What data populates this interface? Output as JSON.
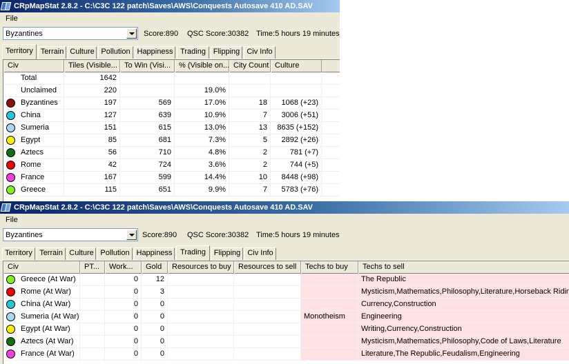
{
  "top_window": {
    "title": "CRpMapStat 2.8.2 - C:\\C3C 122 patch\\Saves\\AWS\\Conquests Autosave 410 AD.SAV",
    "menu": [
      "File"
    ],
    "civ_select": "Byzantines",
    "score": "Score:890",
    "qsc_score": "QSC Score:30382",
    "time": "Time:5 hours 19 minutes",
    "tabs": [
      "Territory",
      "Terrain",
      "Culture",
      "Pollution",
      "Happiness",
      "Trading",
      "Flipping",
      "Civ Info"
    ],
    "active_tab": "Territory",
    "columns": [
      "Civ",
      "Tiles (Visible...",
      "To Win (Visi...",
      "% (Visible on...",
      "City Count",
      "Culture"
    ],
    "rows": [
      {
        "civ": "Total",
        "tiles": "1642",
        "to_win": "",
        "pct": "",
        "cities": "",
        "culture": ""
      },
      {
        "civ": "Unclaimed",
        "tiles": "220",
        "to_win": "",
        "pct": "19.0%",
        "cities": "",
        "culture": ""
      },
      {
        "civ": "Byzantines",
        "color": "#8b1010",
        "tiles": "197",
        "to_win": "569",
        "pct": "17.0%",
        "cities": "18",
        "culture": "1068 (+23)"
      },
      {
        "civ": "China",
        "color": "#20c8d8",
        "tiles": "127",
        "to_win": "639",
        "pct": "10.9%",
        "cities": "7",
        "culture": "3006 (+51)"
      },
      {
        "civ": "Sumeria",
        "color": "#a8d8f0",
        "tiles": "151",
        "to_win": "615",
        "pct": "13.0%",
        "cities": "13",
        "culture": "8635 (+152)"
      },
      {
        "civ": "Egypt",
        "color": "#f8f000",
        "tiles": "85",
        "to_win": "681",
        "pct": "7.3%",
        "cities": "5",
        "culture": "2892 (+26)"
      },
      {
        "civ": "Aztecs",
        "color": "#107010",
        "tiles": "56",
        "to_win": "710",
        "pct": "4.8%",
        "cities": "2",
        "culture": "781 (+7)"
      },
      {
        "civ": "Rome",
        "color": "#f00000",
        "tiles": "42",
        "to_win": "724",
        "pct": "3.6%",
        "cities": "2",
        "culture": "744 (+5)"
      },
      {
        "civ": "France",
        "color": "#f040e0",
        "tiles": "167",
        "to_win": "599",
        "pct": "14.4%",
        "cities": "10",
        "culture": "8448 (+98)"
      },
      {
        "civ": "Greece",
        "color": "#80f020",
        "tiles": "115",
        "to_win": "651",
        "pct": "9.9%",
        "cities": "7",
        "culture": "5783 (+76)"
      }
    ]
  },
  "bottom_window": {
    "title": "CRpMapStat 2.8.2 - C:\\C3C 122 patch\\Saves\\AWS\\Conquests Autosave 410 AD.SAV",
    "menu": [
      "File"
    ],
    "civ_select": "Byzantines",
    "score": "Score:890",
    "qsc_score": "QSC Score:30382",
    "time": "Time:5 hours 19 minutes",
    "tabs": [
      "Territory",
      "Terrain",
      "Culture",
      "Pollution",
      "Happiness",
      "Trading",
      "Flipping",
      "Civ Info"
    ],
    "active_tab": "Trading",
    "columns": [
      "Civ",
      "PT...",
      "Work...",
      "Gold",
      "Resources to buy",
      "Resources to sell",
      "Techs to buy",
      "Techs to sell"
    ],
    "rows": [
      {
        "civ": "Greece (At War)",
        "color": "#80f020",
        "pt": "",
        "work": "0",
        "gold": "12",
        "res_buy": "",
        "res_sell": "",
        "tech_buy": "",
        "tech_sell": "The Republic"
      },
      {
        "civ": "Rome (At War)",
        "color": "#f00000",
        "pt": "",
        "work": "0",
        "gold": "3",
        "res_buy": "",
        "res_sell": "",
        "tech_buy": "",
        "tech_sell": "Mysticism,Mathematics,Philosophy,Literature,Horseback Riding"
      },
      {
        "civ": "China (At War)",
        "color": "#20c8d8",
        "pt": "",
        "work": "0",
        "gold": "0",
        "res_buy": "",
        "res_sell": "",
        "tech_buy": "",
        "tech_sell": "Currency,Construction"
      },
      {
        "civ": "Sumeria (At War)",
        "color": "#a8d8f0",
        "pt": "",
        "work": "0",
        "gold": "0",
        "res_buy": "",
        "res_sell": "",
        "tech_buy": "Monotheism",
        "tech_sell": "Engineering"
      },
      {
        "civ": "Egypt (At War)",
        "color": "#f8f000",
        "pt": "",
        "work": "0",
        "gold": "0",
        "res_buy": "",
        "res_sell": "",
        "tech_buy": "",
        "tech_sell": "Writing,Currency,Construction"
      },
      {
        "civ": "Aztecs (At War)",
        "color": "#107010",
        "pt": "",
        "work": "0",
        "gold": "0",
        "res_buy": "",
        "res_sell": "",
        "tech_buy": "",
        "tech_sell": "Mysticism,Mathematics,Philosophy,Code of Laws,Literature"
      },
      {
        "civ": "France (At War)",
        "color": "#f040e0",
        "pt": "",
        "work": "0",
        "gold": "0",
        "res_buy": "",
        "res_sell": "",
        "tech_buy": "",
        "tech_sell": "Literature,The Republic,Feudalism,Engineering"
      }
    ]
  }
}
